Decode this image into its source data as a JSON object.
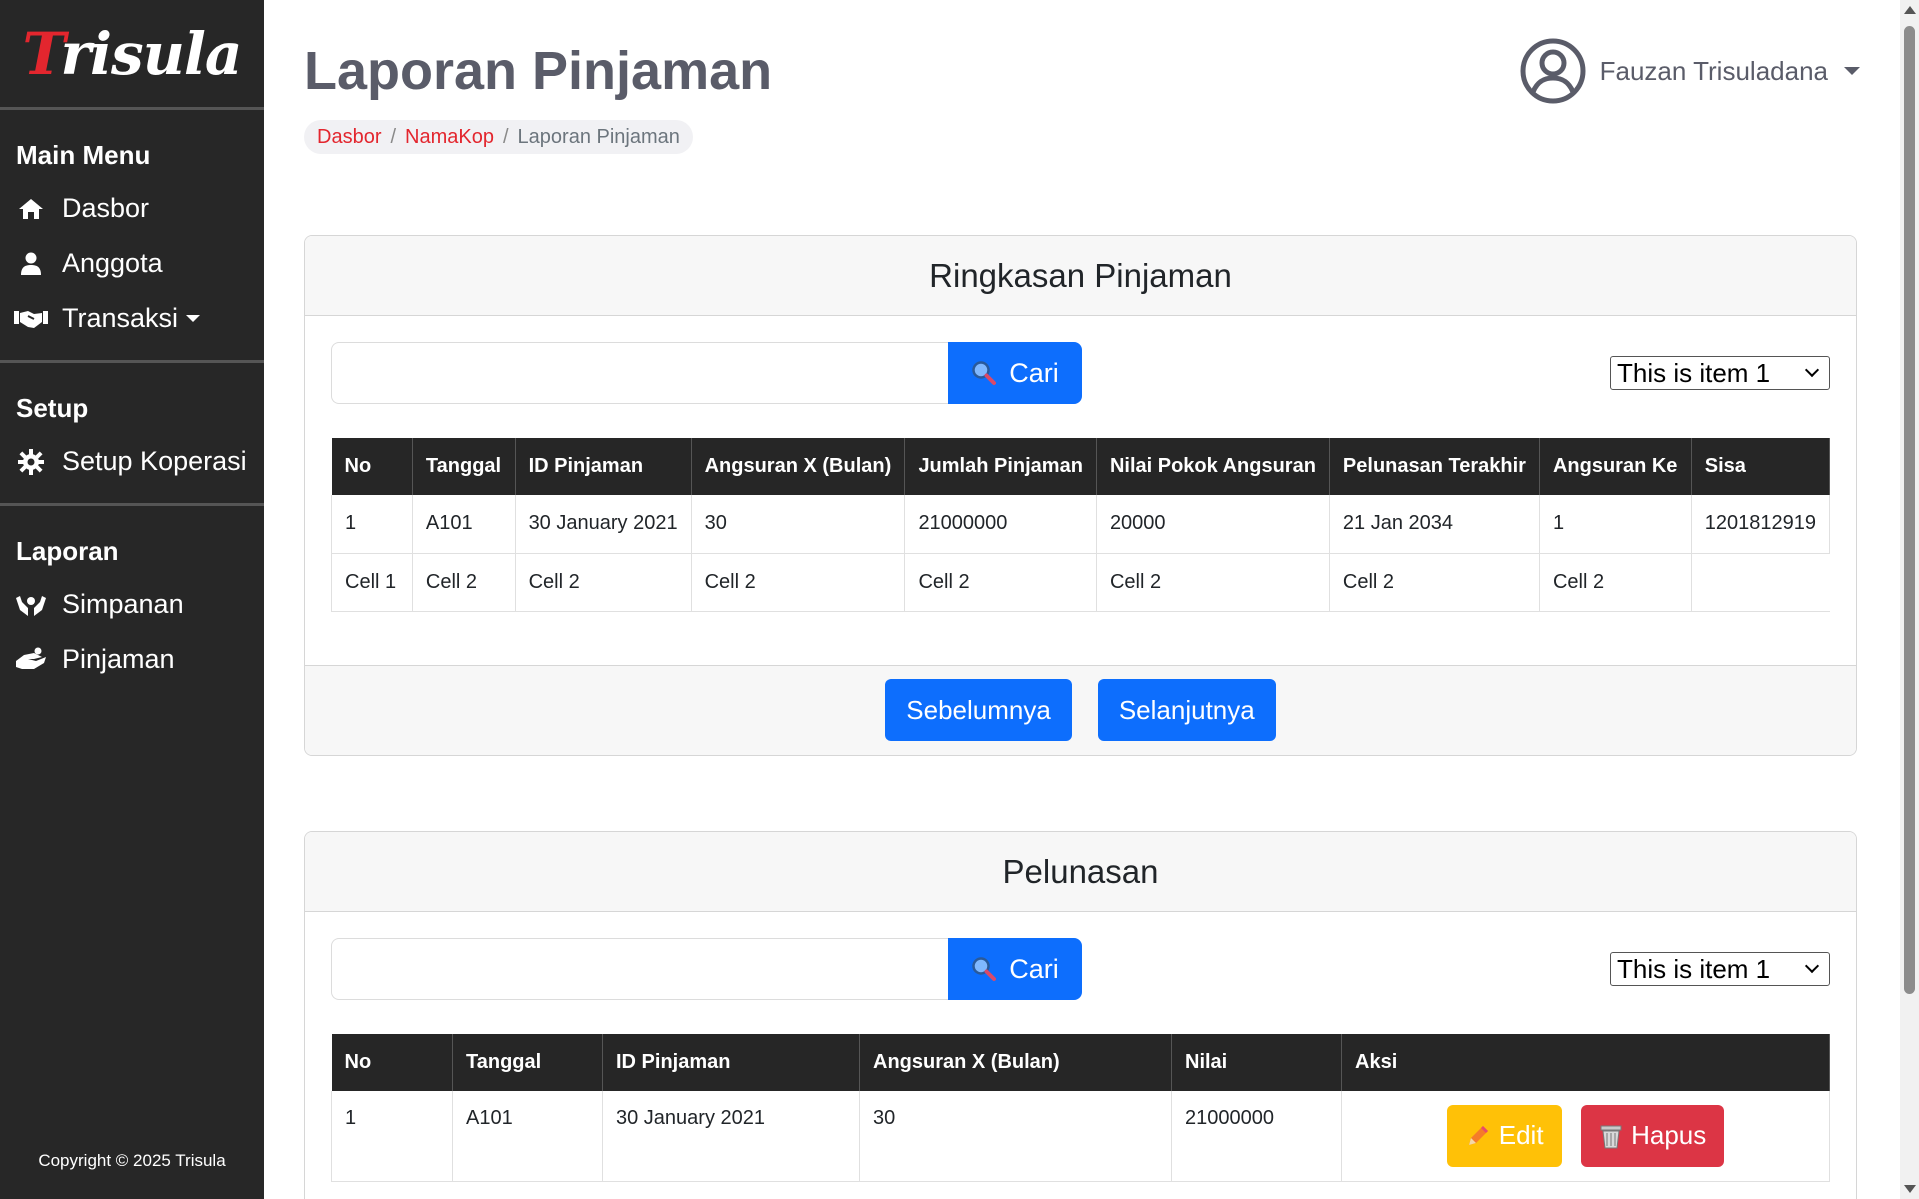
{
  "brand": {
    "name_first": "T",
    "name_rest": "risula"
  },
  "sidebar": {
    "sections": [
      {
        "heading": "Main Menu",
        "items": [
          {
            "label": "Dasbor",
            "icon": "home-icon"
          },
          {
            "label": "Anggota",
            "icon": "user-icon"
          },
          {
            "label": "Transaksi",
            "icon": "handshake-icon",
            "dropdown": true
          }
        ]
      },
      {
        "heading": "Setup",
        "items": [
          {
            "label": "Setup Koperasi",
            "icon": "gear-icon"
          }
        ]
      },
      {
        "heading": "Laporan",
        "items": [
          {
            "label": "Simpanan",
            "icon": "hands-icon"
          },
          {
            "label": "Pinjaman",
            "icon": "hand-holding-icon"
          }
        ]
      }
    ],
    "copyright": "Copyright © 2025 Trisula"
  },
  "header": {
    "title": "Laporan Pinjaman",
    "breadcrumb": [
      "Dasbor",
      "NamaKop",
      "Laporan Pinjaman"
    ],
    "user_name": "Fauzan Trisuladana"
  },
  "summary": {
    "title": "Ringkasan Pinjaman",
    "search_value": "",
    "search_button": "Cari",
    "select_value": "This is item 1",
    "columns": [
      "No",
      "Tanggal",
      "ID Pinjaman",
      "Angsuran X (Bulan)",
      "Jumlah Pinjaman",
      "Nilai Pokok Angsuran",
      "Pelunasan Terakhir",
      "Angsuran Ke",
      "Sisa"
    ],
    "rows": [
      [
        "1",
        "A101",
        "30 January 2021",
        "30",
        "21000000",
        "20000",
        "21 Jan 2034",
        "1",
        "1201812919"
      ],
      [
        "Cell 1",
        "Cell 2",
        "Cell 2",
        "Cell 2",
        "Cell 2",
        "Cell 2",
        "Cell 2",
        "Cell 2",
        ""
      ]
    ],
    "prev_button": "Sebelumnya",
    "next_button": "Selanjutnya"
  },
  "payoff": {
    "title": "Pelunasan",
    "search_value": "",
    "search_button": "Cari",
    "select_value": "This is item 1",
    "columns": [
      "No",
      "Tanggal",
      "ID Pinjaman",
      "Angsuran X (Bulan)",
      "Nilai",
      "Aksi"
    ],
    "rows": [
      [
        "1",
        "A101",
        "30 January 2021",
        "30",
        "21000000"
      ]
    ],
    "edit_button": "Edit",
    "delete_button": "Hapus"
  },
  "colors": {
    "brand_red": "#e3262e",
    "primary": "#0d6efd",
    "warning": "#ffc107",
    "danger": "#dc3545",
    "sidebar": "#272727"
  }
}
